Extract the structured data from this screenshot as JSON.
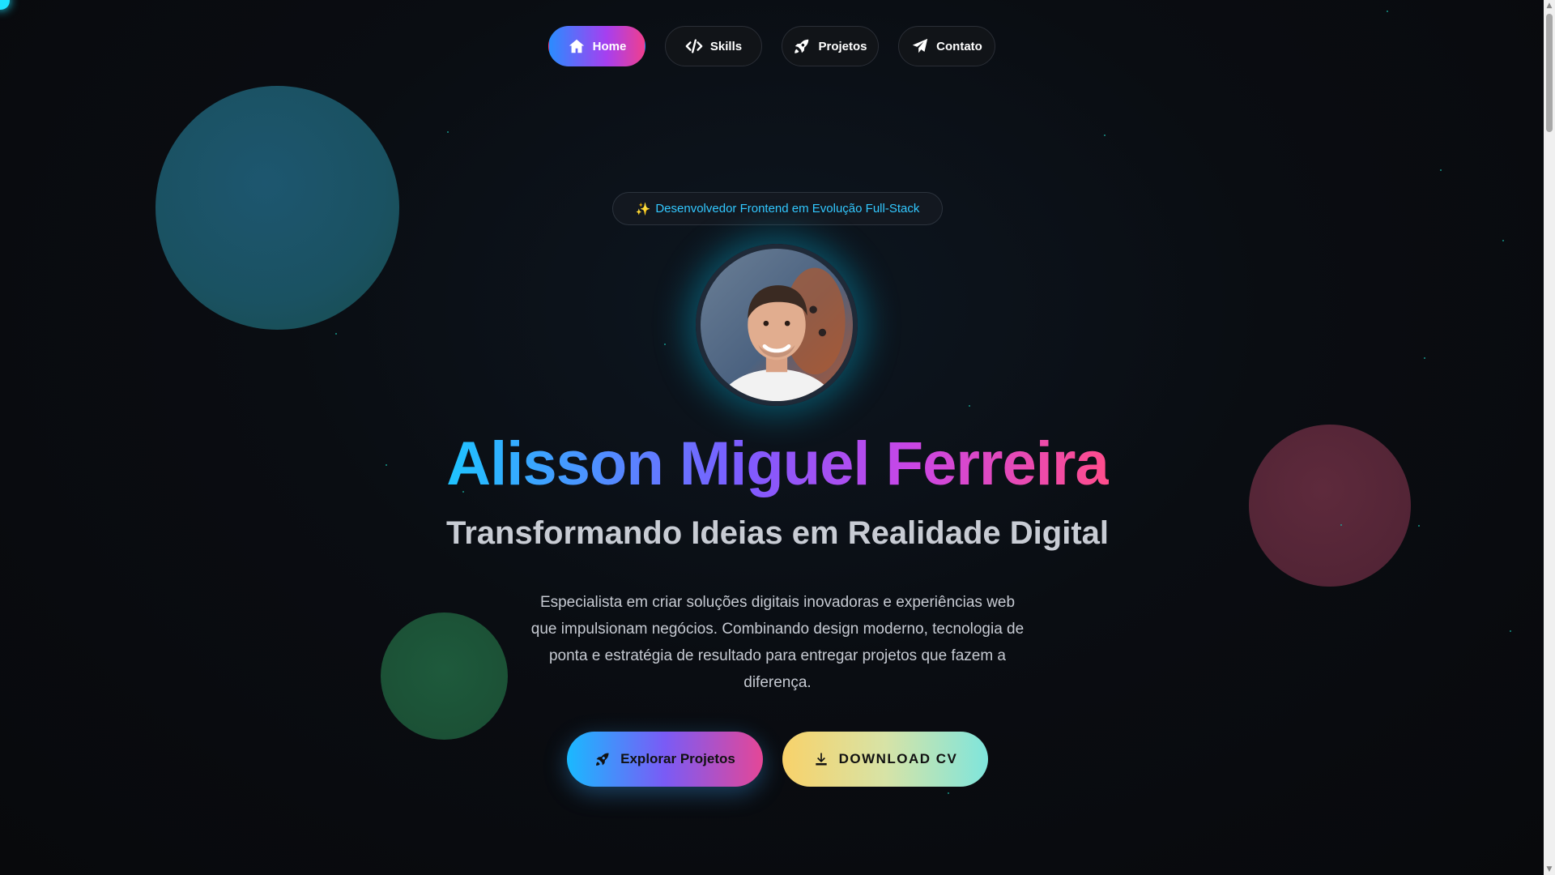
{
  "nav": {
    "items": [
      {
        "label": "Home",
        "icon": "home-icon",
        "active": true
      },
      {
        "label": "Skills",
        "icon": "code-icon",
        "active": false
      },
      {
        "label": "Projetos",
        "icon": "rocket-icon",
        "active": false
      },
      {
        "label": "Contato",
        "icon": "paper-plane-icon",
        "active": false
      }
    ]
  },
  "hero": {
    "badge": "Desenvolvedor Frontend em Evolução Full-Stack",
    "badge_icon": "sparkles-icon",
    "name": "Alisson Miguel Ferreira",
    "tagline": "Transformando Ideias em Realidade Digital",
    "description": "Especialista em criar soluções digitais inovadoras e experiências web que impulsionam negócios. Combinando design moderno, tecnologia de ponta e estratégia de resultado para entregar projetos que fazem a diferença.",
    "primary_button": "Explorar Projetos",
    "primary_icon": "rocket-icon",
    "secondary_button": "DOWNLOAD CV",
    "secondary_icon": "download-icon"
  },
  "colors": {
    "background": "#0a0d12",
    "accent_cyan": "#1ec4ff",
    "accent_purple": "#7e5bff",
    "accent_pink": "#ff4d8c",
    "badge_text": "#32c8ff"
  }
}
